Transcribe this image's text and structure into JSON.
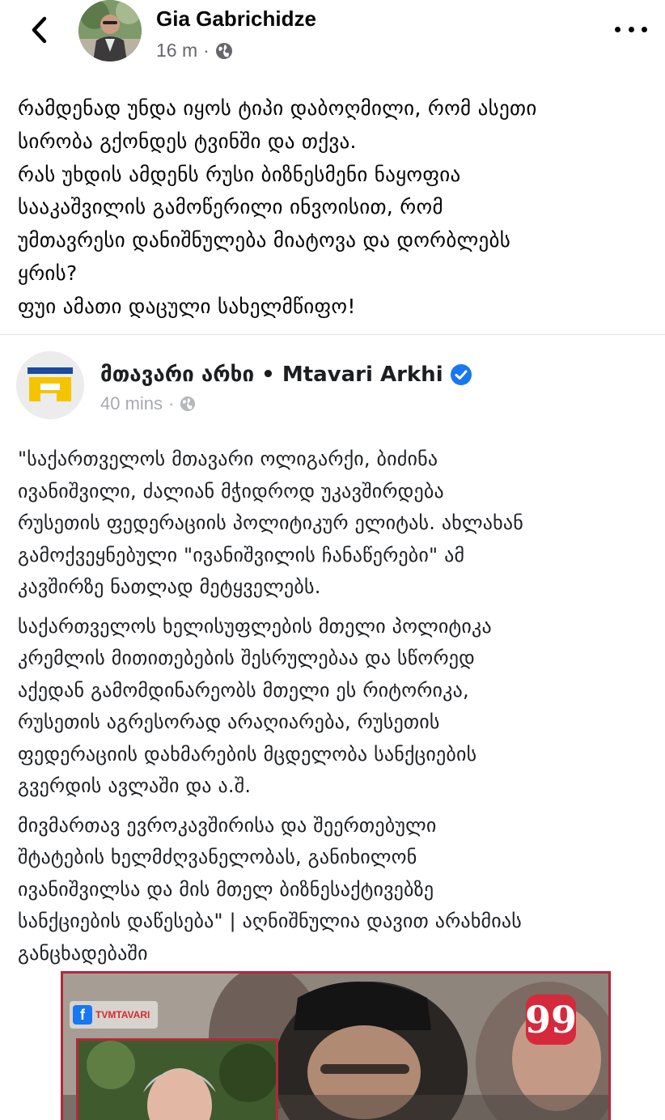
{
  "header": {
    "author_name": "Gia Gabrichidze",
    "timestamp": "16 m",
    "separator": "·",
    "icons": {
      "back": "back-chevron-icon",
      "privacy": "globe-icon",
      "more": "more-options-icon"
    }
  },
  "post": {
    "lines": [
      "რამდენად უნდა იყოს ტიპი დაბოღმილი, რომ ასეთი",
      "სირობა გქონდეს ტვინში და თქვა.",
      "რას უხდის ამდენს რუსი ბიზნესმენი ნაყოფია",
      "სააკაშვილის გამოწერილი ინვოისით, რომ",
      "უმთავრესი დანიშნულება მიატოვა და დორბლებს",
      "ყრის?",
      "ფუი ამათი დაცული სახელმწიფო!"
    ]
  },
  "shared": {
    "page_name": "მთავარი არხი • Mtavari Arkhi",
    "timestamp": "40 mins",
    "separator": "·",
    "icons": {
      "verified": "verified-badge-icon",
      "privacy": "globe-icon"
    },
    "paragraphs": [
      [
        "\"საქართველოს მთავარი ოლიგარქი, ბიძინა",
        "ივანიშვილი, ძალიან მჭიდროდ უკავშირდება",
        "რუსეთის ფედერაციის პოლიტიკურ ელიტას. ახლახან",
        "გამოქვეყნებული \"ივანიშვილის ჩანაწერები\" ამ",
        "კავშირზე ნათლად მეტყველებს."
      ],
      [
        "საქართველოს ხელისუფლების მთელი პოლიტიკა",
        "კრემლის მითითებების შესრულებაა და სწორედ",
        "აქედან გამომდინარეობს მთელი ეს რიტორიკა,",
        "რუსეთის აგრესორად არაღიარება, რუსეთის",
        "ფედერაციის დახმარების მცდელობა სანქციების",
        "გვერდის ავლაში და ა.შ."
      ],
      [
        "მივმართავ ევროკავშირისა და შეერთებული",
        "შტატების ხელმძღვანელობას, განიხილონ",
        "ივანიშვილსა და მის მთელ ბიზნესაქტივებზე",
        "სანქციების დაწესება\" | აღნიშნულია დავით არახმიას",
        "განცხადებაში"
      ]
    ]
  },
  "thumbnail": {
    "badge_text": "TVMTAVARI",
    "fb_letter": "f",
    "quote_glyph": "99",
    "colors": {
      "frame": "#b02a3a",
      "quote_bg": "#d6293c",
      "facebook": "#1877f2"
    }
  }
}
